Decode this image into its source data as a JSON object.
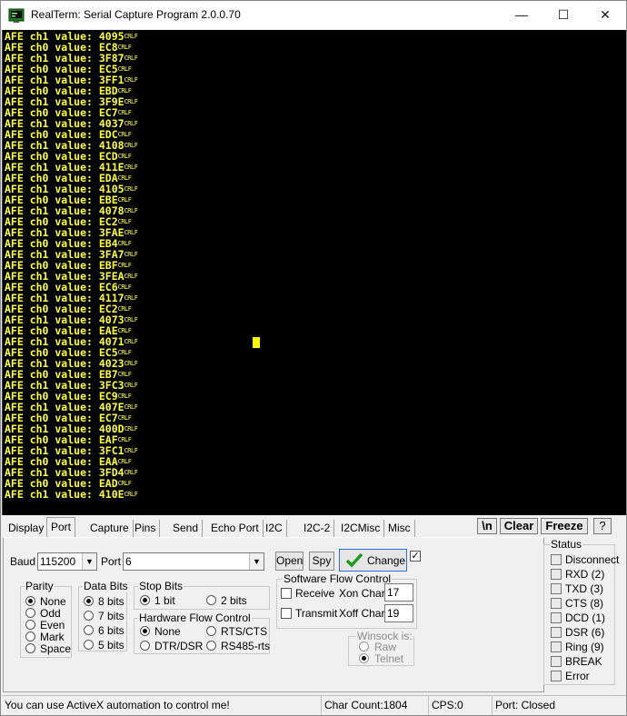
{
  "window": {
    "title": "RealTerm: Serial Capture Program 2.0.0.70",
    "min_glyph": "—",
    "max_glyph": "☐",
    "close_glyph": "✕"
  },
  "terminal": {
    "text_color": "#ffff3a",
    "background": "#000000",
    "crlf_marker": "CRLF",
    "lines": [
      "AFE ch1 value: 4095",
      "AFE ch0 value: EC8",
      "AFE ch1 value: 3F87",
      "AFE ch0 value: EC5",
      "AFE ch1 value: 3FF1",
      "AFE ch0 value: EBD",
      "AFE ch1 value: 3F9E",
      "AFE ch0 value: EC7",
      "AFE ch1 value: 4037",
      "AFE ch0 value: EDC",
      "AFE ch1 value: 4108",
      "AFE ch0 value: ECD",
      "AFE ch1 value: 411E",
      "AFE ch0 value: EDA",
      "AFE ch1 value: 4105",
      "AFE ch0 value: EBE",
      "AFE ch1 value: 4078",
      "AFE ch0 value: EC2",
      "AFE ch1 value: 3FAE",
      "AFE ch0 value: EB4",
      "AFE ch1 value: 3FA7",
      "AFE ch0 value: EBF",
      "AFE ch1 value: 3FEA",
      "AFE ch0 value: EC6",
      "AFE ch1 value: 4117",
      "AFE ch0 value: EC2",
      "AFE ch1 value: 4073",
      "AFE ch0 value: EAE",
      "AFE ch1 value: 4071",
      "AFE ch0 value: EC5",
      "AFE ch1 value: 4023",
      "AFE ch0 value: EB7",
      "AFE ch1 value: 3FC3",
      "AFE ch0 value: EC9",
      "AFE ch1 value: 407E",
      "AFE ch0 value: EC7",
      "AFE ch1 value: 400D",
      "AFE ch0 value: EAF",
      "AFE ch1 value: 3FC1",
      "AFE ch0 value: EAA",
      "AFE ch1 value: 3FD4",
      "AFE ch0 value: EAD",
      "AFE ch1 value: 410E"
    ]
  },
  "tabs": [
    "Display",
    "Port",
    "Capture",
    "Pins",
    "Send",
    "Echo Port",
    "I2C",
    "I2C-2",
    "I2CMisc",
    "Misc"
  ],
  "active_tab": "Port",
  "toolbar": {
    "newline_label": "\\n",
    "clear_label": "Clear",
    "freeze_label": "Freeze",
    "help_label": "?"
  },
  "port": {
    "baud_label": "Baud",
    "baud_value": "115200",
    "port_label": "Port",
    "port_value": "6",
    "open_label": "Open",
    "spy_label": "Spy",
    "change_label": "Change",
    "change_checked": true
  },
  "parity": {
    "title": "Parity",
    "options": [
      "None",
      "Odd",
      "Even",
      "Mark",
      "Space"
    ],
    "selected": "None"
  },
  "data_bits": {
    "title": "Data Bits",
    "options": [
      "8 bits",
      "7 bits",
      "6 bits",
      "5 bits"
    ],
    "selected": "8 bits"
  },
  "stop_bits": {
    "title": "Stop Bits",
    "options": [
      "1 bit",
      "2 bits"
    ],
    "selected": "1 bit"
  },
  "hw_flow": {
    "title": "Hardware Flow Control",
    "options": [
      "None",
      "RTS/CTS",
      "DTR/DSR",
      "RS485-rts"
    ],
    "selected": "None"
  },
  "sw_flow": {
    "title": "Software Flow Control",
    "receive_label": "Receive",
    "transmit_label": "Transmit",
    "xon_label": "Xon Char:",
    "xon_value": "17",
    "xoff_label": "Xoff Char:",
    "xoff_value": "19"
  },
  "winsock": {
    "title": "Winsock is:",
    "options": [
      "Raw",
      "Telnet"
    ],
    "selected": "Telnet"
  },
  "status": {
    "title": "Status",
    "items": [
      "Disconnect",
      "RXD (2)",
      "TXD (3)",
      "CTS (8)",
      "DCD (1)",
      "DSR (6)",
      "Ring (9)",
      "BREAK",
      "Error"
    ]
  },
  "statusbar": {
    "message": "You can use ActiveX automation to control me!",
    "char_count": "Char Count:1804",
    "cps": "CPS:0",
    "port_status": "Port: Closed"
  }
}
